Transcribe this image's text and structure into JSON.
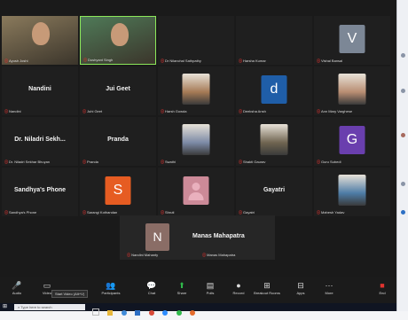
{
  "meeting": {
    "tiles": [
      {
        "label": "Ayush Joshi",
        "type": "video",
        "bg": "#8a7a5c"
      },
      {
        "label": "Dushyant Singh",
        "type": "video",
        "bg": "#4f7a58",
        "active_speaker": true
      },
      {
        "label": "Dr Nilanchal Sathpathy",
        "type": "blank"
      },
      {
        "label": "Harsha Kumar",
        "type": "blank"
      },
      {
        "label": "Vishal Bansal",
        "type": "avatar",
        "letter": "V",
        "color": "#7c8796"
      },
      {
        "label": "Nandini",
        "type": "name",
        "bigname": "Nandini"
      },
      {
        "label": "Juhi Geet",
        "type": "name",
        "bigname": "Jui Geet"
      },
      {
        "label": "Harsh Gowda",
        "type": "photo",
        "photo_color": "#a57a55"
      },
      {
        "label": "Deeksha Ansh",
        "type": "avatar",
        "letter": "d",
        "color": "#1f5ea8"
      },
      {
        "label": "Ann Mary Varghese",
        "type": "photo",
        "photo_color": "#b88d72"
      },
      {
        "label": "Dr. Niladri Sekhar Bhuyan",
        "type": "name",
        "bigname": "Dr. Niladri Sekh..."
      },
      {
        "label": "Pranda",
        "type": "name",
        "bigname": "Pranda"
      },
      {
        "label": "Swathi",
        "type": "photo",
        "photo_color": "#7c8aa6"
      },
      {
        "label": "Shakti Gaurav",
        "type": "photo",
        "photo_color": "#6f6450"
      },
      {
        "label": "Guru Subedi",
        "type": "avatar",
        "letter": "G",
        "color": "#6a3fae"
      },
      {
        "label": "Sandhya's Phone",
        "type": "name",
        "bigname": "Sandhya's Phone"
      },
      {
        "label": "Sarangi Kothandan",
        "type": "avatar",
        "letter": "S",
        "color": "#e65c22"
      },
      {
        "label": "Shruti",
        "type": "avatar",
        "letter": "",
        "color": "#cc8a98"
      },
      {
        "label": "Gayatri",
        "type": "name",
        "bigname": "Gayatri"
      },
      {
        "label": "Mahesh Yadav",
        "type": "photo",
        "photo_color": "#4d7ca6"
      }
    ],
    "bottom_tile": {
      "label": "Manas Mahapatra",
      "avatar_letter": "N",
      "avatar_color": "#8a6d66",
      "bigname": "Manas Mahapatra",
      "small_left": "Nandini Mahanty"
    }
  },
  "toolbar": [
    {
      "label": "Audio",
      "icon": "mic-icon",
      "glyph": "🎤"
    },
    {
      "label": "Video",
      "icon": "video-camera-icon",
      "glyph": "▭"
    },
    {
      "label": "Participants",
      "icon": "participants-icon",
      "glyph": "👥"
    },
    {
      "label": "Chat",
      "icon": "chat-icon",
      "glyph": "💬"
    },
    {
      "label": "Share",
      "icon": "share-screen-icon",
      "glyph": "⬆"
    },
    {
      "label": "Polls",
      "icon": "polls-icon",
      "glyph": "▤"
    },
    {
      "label": "Record",
      "icon": "record-icon",
      "glyph": "●"
    },
    {
      "label": "Breakout Rooms",
      "icon": "breakout-rooms-icon",
      "glyph": "⊞"
    },
    {
      "label": "Apps",
      "icon": "apps-icon",
      "glyph": "⊟"
    },
    {
      "label": "More",
      "icon": "more-icon",
      "glyph": "⋯"
    },
    {
      "label": "End",
      "icon": "end-call-icon",
      "glyph": "■"
    }
  ],
  "tooltip": "Start Video (Alt+V)",
  "taskbar": {
    "search_placeholder": "Type here to search"
  },
  "colors": {
    "active_speaker": "#8ce85a",
    "muted": "#e0332f",
    "share": "#2fb94a",
    "end": "#e0332f"
  }
}
